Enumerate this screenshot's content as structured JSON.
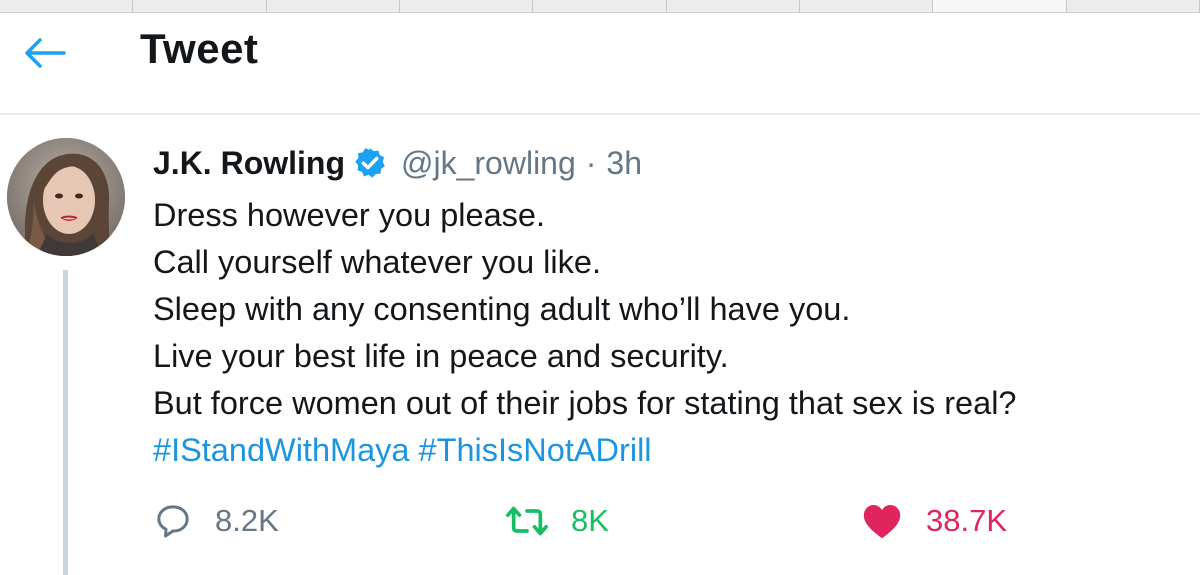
{
  "header": {
    "title": "Tweet",
    "back_icon": "arrow-left-icon"
  },
  "tweet": {
    "author_name": "J.K. Rowling",
    "verified_icon": "verified-badge-icon",
    "handle": "@jk_rowling",
    "separator": "·",
    "time": "3h",
    "lines": [
      "Dress however you please.",
      "Call yourself whatever you like.",
      "Sleep with any consenting adult who’ll have you.",
      "Live your best life in peace and security.",
      "But force women out of their jobs for stating that sex is real?"
    ],
    "hashtags": [
      "#IStandWithMaya",
      "#ThisIsNotADrill"
    ]
  },
  "actions": {
    "reply_count": "8.2K",
    "retweet_count": "8K",
    "like_count": "38.7K",
    "reply_icon": "speech-bubble-icon",
    "retweet_icon": "retweet-arrows-icon",
    "like_icon": "heart-icon"
  },
  "colors": {
    "accent": "#1da1f2",
    "hashtag": "#1b95e0",
    "retweet_active": "#17bf63",
    "like_active": "#e0245e",
    "muted": "#657786"
  }
}
